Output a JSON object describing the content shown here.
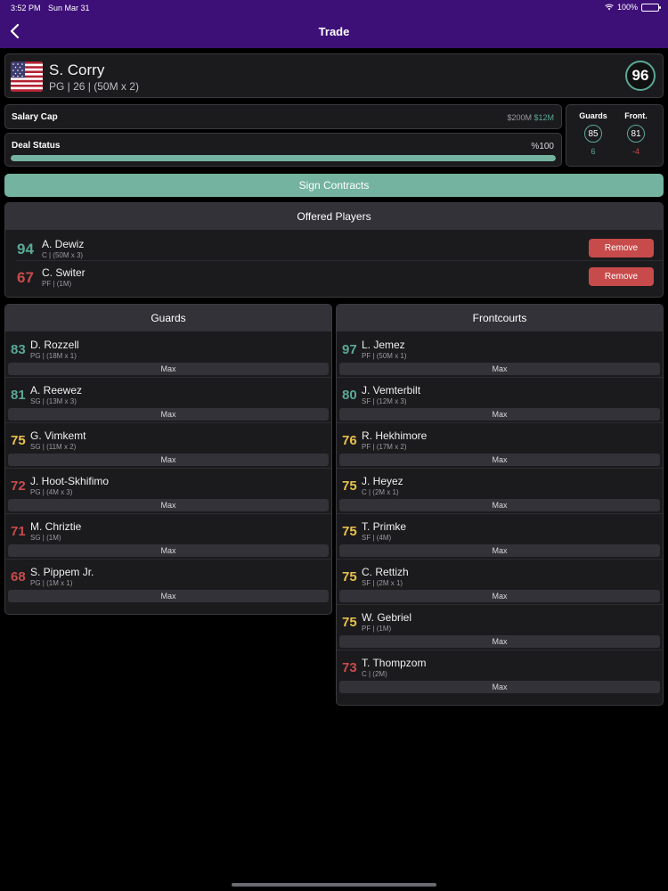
{
  "status_bar": {
    "time": "3:52 PM",
    "date": "Sun Mar 31",
    "battery": "100%"
  },
  "nav": {
    "title": "Trade",
    "back_icon": "chevron-left-icon"
  },
  "player": {
    "name": "S. Corry",
    "details": "PG | 26 | (50M x 2)",
    "overall": "96",
    "flag": "us-flag"
  },
  "salary": {
    "label": "Salary Cap",
    "cap": "$200M",
    "space": "$12M"
  },
  "deal": {
    "label": "Deal Status",
    "percent_text": "%100",
    "progress": 1.0
  },
  "ratings": {
    "guards": {
      "label": "Guards",
      "value": "85",
      "delta": "6"
    },
    "front": {
      "label": "Front.",
      "value": "81",
      "delta": "-4"
    }
  },
  "sign_button": "Sign Contracts",
  "offered": {
    "title": "Offered Players",
    "remove_label": "Remove",
    "players": [
      {
        "ovr": "94",
        "name": "A. Dewiz",
        "details": "C | (50M x 3)",
        "tier": "green"
      },
      {
        "ovr": "67",
        "name": "C. Switer",
        "details": "PF | (1M)",
        "tier": "red"
      }
    ]
  },
  "max_label": "Max",
  "guards": {
    "title": "Guards",
    "players": [
      {
        "ovr": "83",
        "name": "D. Rozzell",
        "details": "PG | (18M x 1)",
        "tier": "green"
      },
      {
        "ovr": "81",
        "name": "A. Reewez",
        "details": "SG | (13M x 3)",
        "tier": "green"
      },
      {
        "ovr": "75",
        "name": "G. Vimkemt",
        "details": "SG | (11M x 2)",
        "tier": "yellow"
      },
      {
        "ovr": "72",
        "name": "J. Hoot-Skhifimo",
        "details": "PG | (4M x 3)",
        "tier": "red"
      },
      {
        "ovr": "71",
        "name": "M. Chriztie",
        "details": "SG | (1M)",
        "tier": "red"
      },
      {
        "ovr": "68",
        "name": "S. Pippem Jr.",
        "details": "PG | (1M x 1)",
        "tier": "red"
      }
    ]
  },
  "frontcourts": {
    "title": "Frontcourts",
    "players": [
      {
        "ovr": "97",
        "name": "L. Jemez",
        "details": "PF | (50M x 1)",
        "tier": "green"
      },
      {
        "ovr": "80",
        "name": "J. Vemterbilt",
        "details": "SF | (12M x 3)",
        "tier": "green"
      },
      {
        "ovr": "76",
        "name": "R. Hekhimore",
        "details": "PF | (17M x 2)",
        "tier": "yellow"
      },
      {
        "ovr": "75",
        "name": "J. Heyez",
        "details": "C | (2M x 1)",
        "tier": "yellow"
      },
      {
        "ovr": "75",
        "name": "T. Primke",
        "details": "SF | (4M)",
        "tier": "yellow"
      },
      {
        "ovr": "75",
        "name": "C. Rettizh",
        "details": "SF | (2M x 1)",
        "tier": "yellow"
      },
      {
        "ovr": "75",
        "name": "W. Gebriel",
        "details": "PF | (1M)",
        "tier": "yellow"
      },
      {
        "ovr": "73",
        "name": "T. Thompzom",
        "details": "C | (2M)",
        "tier": "red"
      }
    ]
  },
  "colors": {
    "nav_bg": "#3d1077",
    "accent_green": "#74b3a0",
    "rating_green": "#5aa896",
    "rating_yellow": "#e8c04a",
    "rating_red": "#c84b4b"
  }
}
